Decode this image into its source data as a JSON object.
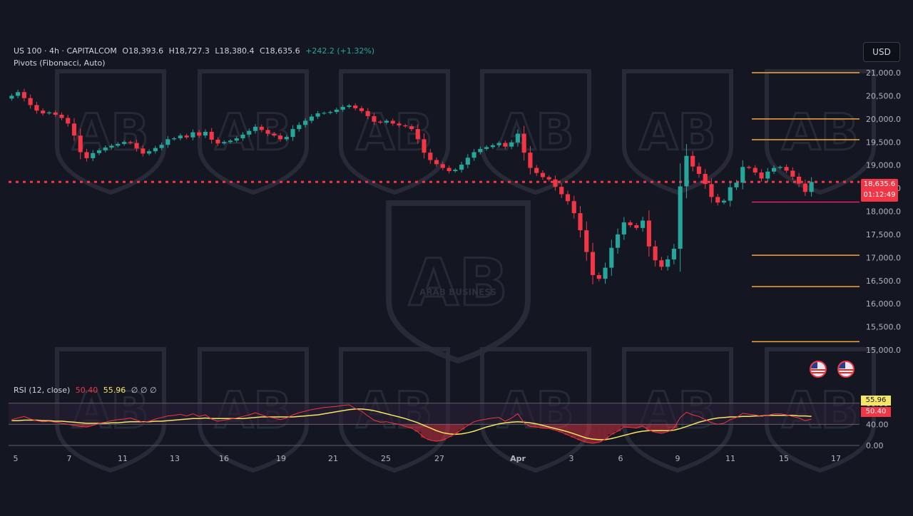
{
  "header": {
    "symbol": "US 100 · 4h · CAPITALCOM",
    "open": "O18,393.6",
    "high": "H18,727.3",
    "low": "L18,380.4",
    "close": "C18,635.6",
    "change": "+242.2 (+1.32%)",
    "indicator": "Pivots (Fibonacci, Auto)"
  },
  "currency": "USD",
  "price_tag": {
    "price": "18,635.6",
    "countdown": "01:12:49"
  },
  "rsi_header": {
    "label": "RSI (12, close)",
    "rsi_value": "50.40",
    "ma_value": "55.96",
    "extras": "∅ ∅ ∅"
  },
  "rsi_tags": {
    "ma": "55.96",
    "rsi": "50.40"
  },
  "colors": {
    "up": "#26a69a",
    "down": "#f23645",
    "pivot": "#f7a541",
    "pivot_support": "#e91e63",
    "rsi": "#f23645",
    "rsi_ma": "#f5e663"
  },
  "icons": [
    "us-flag-event-icon",
    "us-flag-event-icon"
  ],
  "watermark": "ARAB BUSINESS",
  "chart_data": [
    {
      "type": "candlestick",
      "ylim": [
        15000,
        21000
      ],
      "yticks": [
        "21,000.0",
        "20,500.0",
        "20,000.0",
        "19,500.0",
        "19,000.0",
        "18,500.0",
        "18,000.0",
        "17,500.0",
        "17,000.0",
        "16,500.0",
        "16,000.0",
        "15,500.0",
        "15,000.0"
      ],
      "xticks": [
        "5",
        "7",
        "11",
        "13",
        "16",
        "19",
        "21",
        "25",
        "27",
        "Apr",
        "3",
        "6",
        "9",
        "11",
        "15",
        "17"
      ],
      "close": [
        20500,
        20580,
        20450,
        20300,
        20180,
        20120,
        20140,
        20090,
        20020,
        19900,
        19640,
        19280,
        19150,
        19260,
        19320,
        19380,
        19420,
        19460,
        19500,
        19480,
        19360,
        19250,
        19300,
        19370,
        19440,
        19560,
        19580,
        19640,
        19600,
        19710,
        19640,
        19720,
        19550,
        19470,
        19500,
        19530,
        19580,
        19660,
        19740,
        19830,
        19760,
        19680,
        19640,
        19560,
        19610,
        19780,
        19870,
        19960,
        20050,
        20120,
        20130,
        20150,
        20200,
        20260,
        20290,
        20230,
        20170,
        20060,
        19940,
        19920,
        19960,
        19900,
        19860,
        19840,
        19780,
        19560,
        19270,
        19110,
        19020,
        18940,
        18870,
        18900,
        19010,
        19160,
        19280,
        19350,
        19390,
        19430,
        19480,
        19400,
        19490,
        19680,
        19270,
        18940,
        18830,
        18740,
        18690,
        18530,
        18370,
        18220,
        17960,
        17590,
        17120,
        16620,
        16540,
        16780,
        17210,
        17500,
        17760,
        17700,
        17640,
        17800,
        17240,
        16940,
        16800,
        16960,
        17190,
        18540,
        19200,
        18970,
        18810,
        18590,
        18310,
        18190,
        18230,
        18520,
        18620,
        18960,
        18940,
        18840,
        18710,
        18860,
        18940,
        18960,
        18880,
        18750,
        18600,
        18420,
        18636
      ],
      "pivot_levels": [
        21000,
        20000,
        19550,
        18200,
        17050,
        16370,
        15180
      ],
      "current_price": 18636
    },
    {
      "type": "line",
      "title": "RSI (12, close)",
      "ylim": [
        0,
        100
      ],
      "yticks": [
        "80.00",
        "40.00",
        "0.00"
      ],
      "series": [
        {
          "name": "RSI",
          "values": [
            49,
            52,
            55,
            50,
            47,
            45,
            46,
            44,
            42,
            40,
            38,
            36,
            35,
            38,
            42,
            44,
            47,
            49,
            50,
            52,
            48,
            44,
            46,
            50,
            53,
            56,
            57,
            59,
            56,
            60,
            55,
            58,
            50,
            46,
            48,
            50,
            52,
            55,
            58,
            62,
            58,
            54,
            52,
            49,
            52,
            58,
            62,
            65,
            68,
            70,
            72,
            73,
            74,
            76,
            77,
            70,
            65,
            56,
            48,
            44,
            45,
            42,
            40,
            36,
            33,
            26,
            15,
            10,
            8,
            10,
            16,
            22,
            30,
            38,
            45,
            48,
            50,
            52,
            53,
            46,
            52,
            60,
            43,
            36,
            35,
            33,
            32,
            29,
            25,
            20,
            15,
            10,
            6,
            4,
            6,
            12,
            21,
            27,
            35,
            34,
            33,
            37,
            29,
            25,
            23,
            26,
            33,
            53,
            63,
            58,
            55,
            49,
            43,
            40,
            42,
            49,
            53,
            61,
            59,
            58,
            55,
            57,
            60,
            60,
            58,
            55,
            52,
            47,
            50
          ]
        },
        {
          "name": "MA",
          "values": [
            47,
            47,
            48,
            48,
            48,
            47,
            47,
            46,
            46,
            45,
            44,
            43,
            42,
            42,
            42,
            42,
            43,
            43,
            44,
            45,
            45,
            45,
            45,
            46,
            46,
            47,
            48,
            49,
            50,
            51,
            51,
            52,
            51,
            51,
            51,
            51,
            51,
            51,
            52,
            53,
            54,
            54,
            54,
            54,
            54,
            54,
            55,
            56,
            57,
            58,
            60,
            62,
            64,
            66,
            68,
            69,
            69,
            68,
            66,
            63,
            60,
            57,
            54,
            51,
            47,
            43,
            38,
            33,
            28,
            24,
            22,
            21,
            22,
            24,
            27,
            31,
            35,
            38,
            41,
            43,
            44,
            45,
            44,
            43,
            41,
            38,
            35,
            32,
            29,
            26,
            22,
            18,
            14,
            12,
            11,
            11,
            13,
            16,
            19,
            22,
            25,
            27,
            28,
            28,
            28,
            28,
            29,
            32,
            36,
            40,
            44,
            47,
            50,
            52,
            53,
            54,
            54,
            55,
            55,
            56,
            56,
            57,
            57,
            57,
            57,
            57,
            56,
            56,
            55
          ]
        }
      ],
      "levels": [
        80,
        40,
        0
      ]
    }
  ]
}
